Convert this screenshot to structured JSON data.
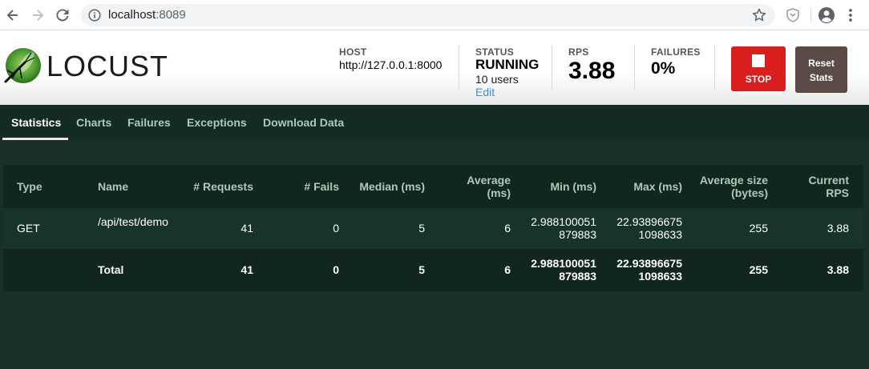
{
  "browser": {
    "url_host": "localhost",
    "url_port": ":8089"
  },
  "header": {
    "logo_text": "LOCUST",
    "host_label": "HOST",
    "host_value": "http://127.0.0.1:8000",
    "status_label": "STATUS",
    "status_value": "RUNNING",
    "users_text": "10 users",
    "edit_label": "Edit",
    "rps_label": "RPS",
    "rps_value": "3.88",
    "failures_label": "FAILURES",
    "failures_value": "0%",
    "stop_label": "STOP",
    "reset_label": "Reset Stats"
  },
  "tabs": [
    {
      "label": "Statistics"
    },
    {
      "label": "Charts"
    },
    {
      "label": "Failures"
    },
    {
      "label": "Exceptions"
    },
    {
      "label": "Download Data"
    }
  ],
  "table": {
    "columns": [
      "Type",
      "Name",
      "# Requests",
      "# Fails",
      "Median (ms)",
      "Average (ms)",
      "Min (ms)",
      "Max (ms)",
      "Average size (bytes)",
      "Current RPS"
    ],
    "rows": [
      {
        "type": "GET",
        "name": "/api/test/demo",
        "requests": "41",
        "fails": "0",
        "median": "5",
        "average": "6",
        "min": "2.988100051879883",
        "max": "22.938966751098633",
        "avg_size": "255",
        "current_rps": "3.88"
      }
    ],
    "total": {
      "type": "",
      "name": "Total",
      "requests": "41",
      "fails": "0",
      "median": "5",
      "average": "6",
      "min": "2.988100051879883",
      "max": "22.938966751098633",
      "avg_size": "255",
      "current_rps": "3.88"
    }
  },
  "colors": {
    "background": "#183028",
    "stop_button": "#d81e1e",
    "reset_button": "#5a4a48",
    "tab_text": "#a9cbb8",
    "edit_link": "#3a8fd1"
  }
}
